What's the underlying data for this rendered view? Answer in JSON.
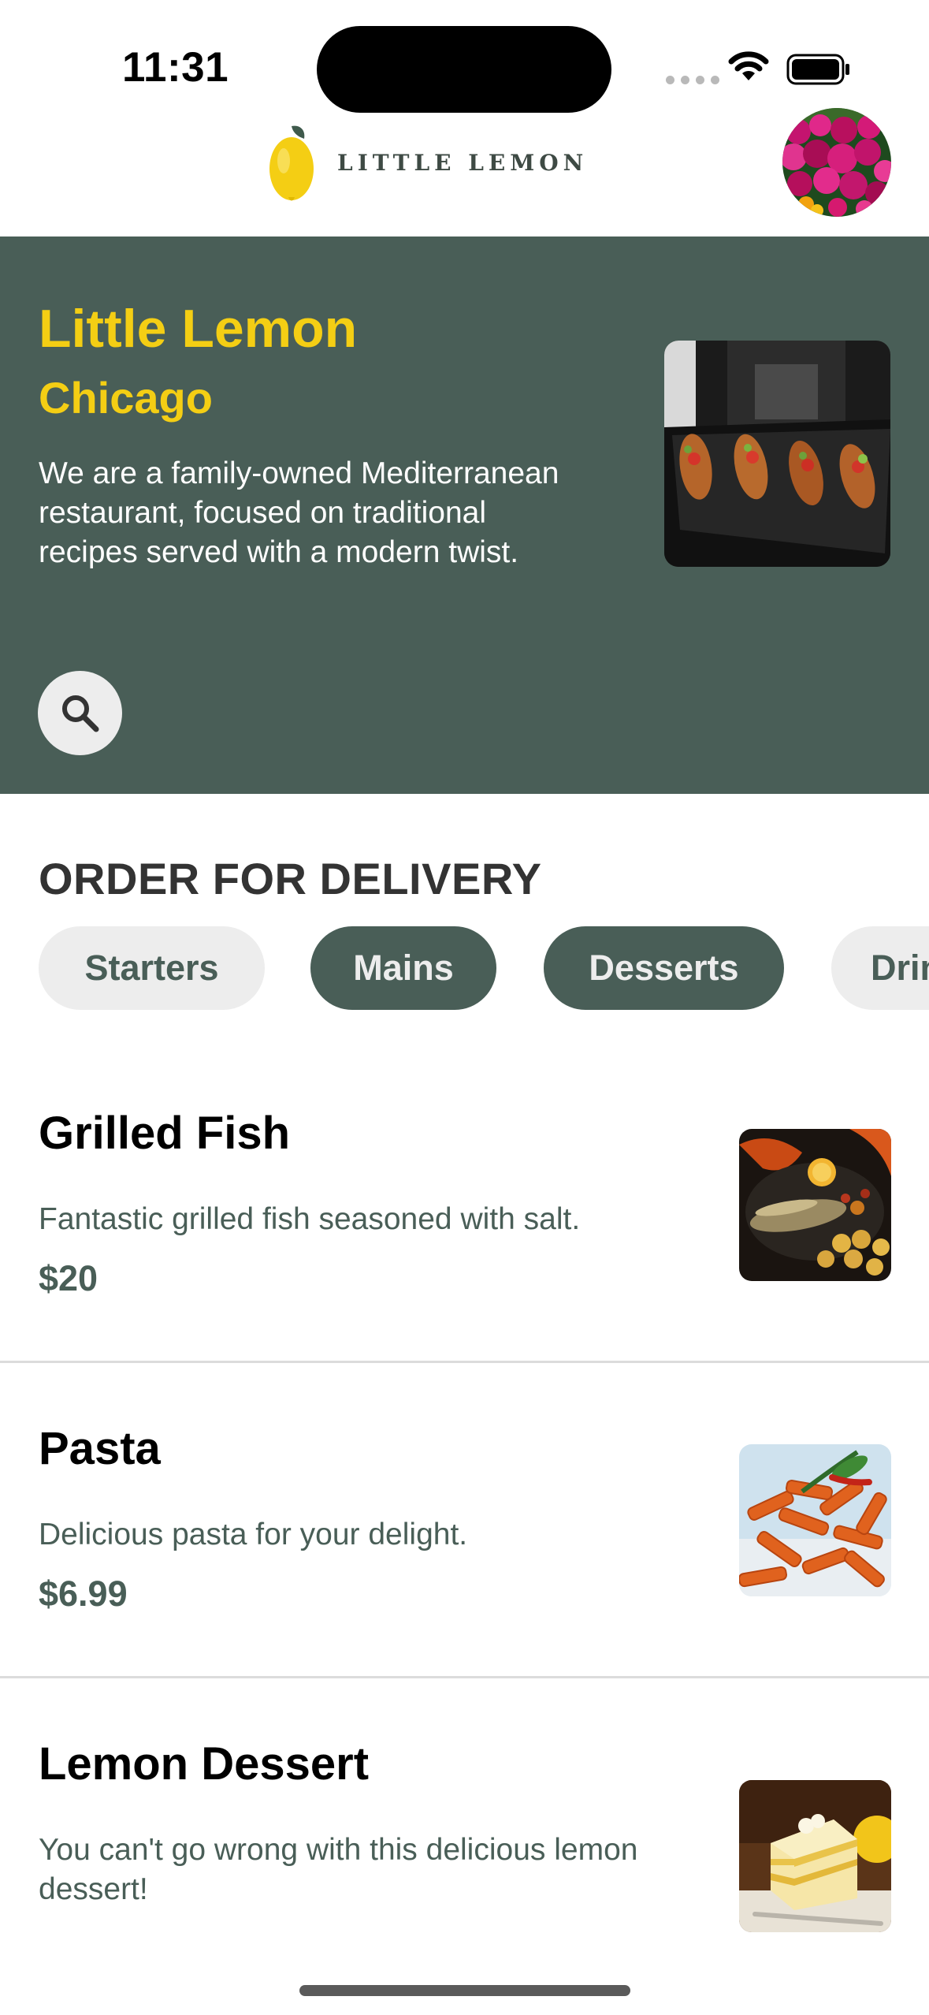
{
  "status_bar": {
    "time": "11:31"
  },
  "header": {
    "logo_text": "LITTLE LEMON"
  },
  "hero": {
    "title": "Little Lemon",
    "city": "Chicago",
    "description": "We are a family-owned Mediterranean restaurant, focused on traditional recipes served with a modern twist."
  },
  "order": {
    "title": "ORDER FOR DELIVERY",
    "categories": [
      "Starters",
      "Mains",
      "Desserts",
      "Drinks"
    ]
  },
  "menu": [
    {
      "name": "Grilled Fish",
      "description": "Fantastic grilled fish seasoned with salt.",
      "price": "$20"
    },
    {
      "name": "Pasta",
      "description": "Delicious pasta for your delight.",
      "price": "$6.99"
    },
    {
      "name": "Lemon Dessert",
      "description": "You can't go wrong with this delicious lemon dessert!",
      "price": ""
    }
  ],
  "colors": {
    "primary_green": "#495e57",
    "primary_yellow": "#f4ce14",
    "chip_light": "#ededed"
  }
}
